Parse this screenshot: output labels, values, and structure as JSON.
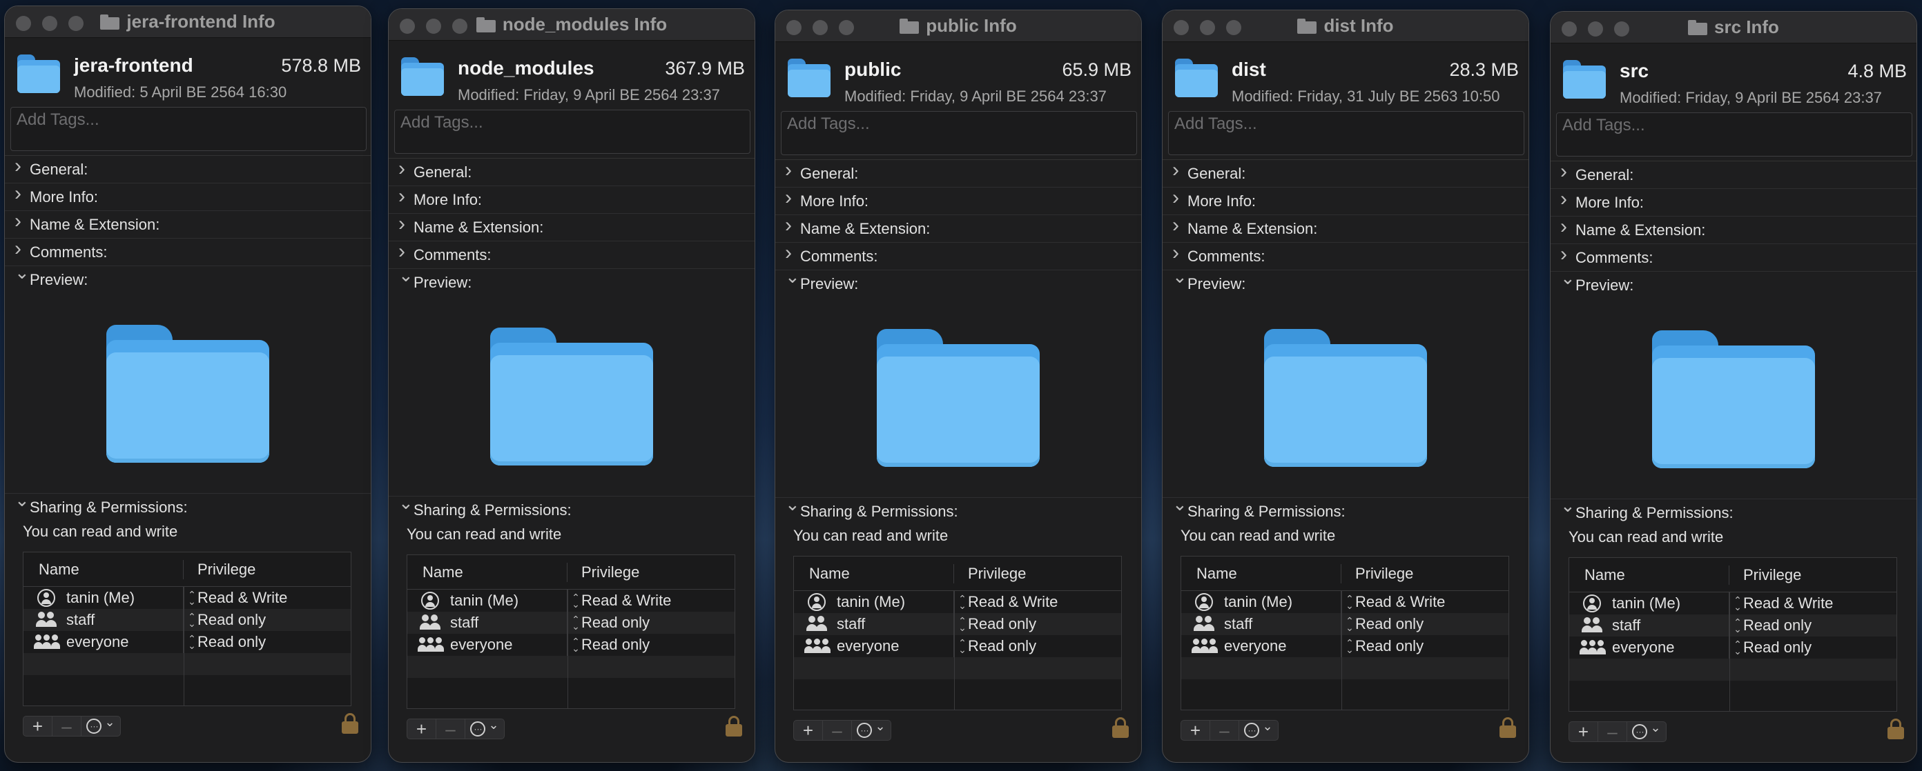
{
  "windows": [
    {
      "title": "jera-frontend Info",
      "name": "jera-frontend",
      "size": "578.8 MB",
      "modified": "Modified: 5 April BE 2564 16:30"
    },
    {
      "title": "node_modules Info",
      "name": "node_modules",
      "size": "367.9 MB",
      "modified": "Modified: Friday, 9 April BE 2564 23:37"
    },
    {
      "title": "public Info",
      "name": "public",
      "size": "65.9 MB",
      "modified": "Modified: Friday, 9 April BE 2564 23:37"
    },
    {
      "title": "dist Info",
      "name": "dist",
      "size": "28.3 MB",
      "modified": "Modified: Friday, 31 July BE 2563 10:50"
    },
    {
      "title": "src Info",
      "name": "src",
      "size": "4.8 MB",
      "modified": "Modified: Friday, 9 April BE 2564 23:37"
    }
  ],
  "common": {
    "tags_placeholder": "Add Tags...",
    "sections": [
      "General:",
      "More Info:",
      "Name & Extension:",
      "Comments:"
    ],
    "preview_label": "Preview:",
    "sharing_label": "Sharing & Permissions:",
    "sharing_status": "You can read and write",
    "col_name": "Name",
    "col_privilege": "Privilege",
    "permissions": [
      {
        "user": "tanin (Me)",
        "privilege": "Read & Write",
        "icon": "user-icon"
      },
      {
        "user": "staff",
        "privilege": "Read only",
        "icon": "group-icon"
      },
      {
        "user": "everyone",
        "privilege": "Read only",
        "icon": "everyone-icon"
      }
    ],
    "add_symbol": "+",
    "remove_symbol": "–",
    "action_chevron": "⌄"
  }
}
